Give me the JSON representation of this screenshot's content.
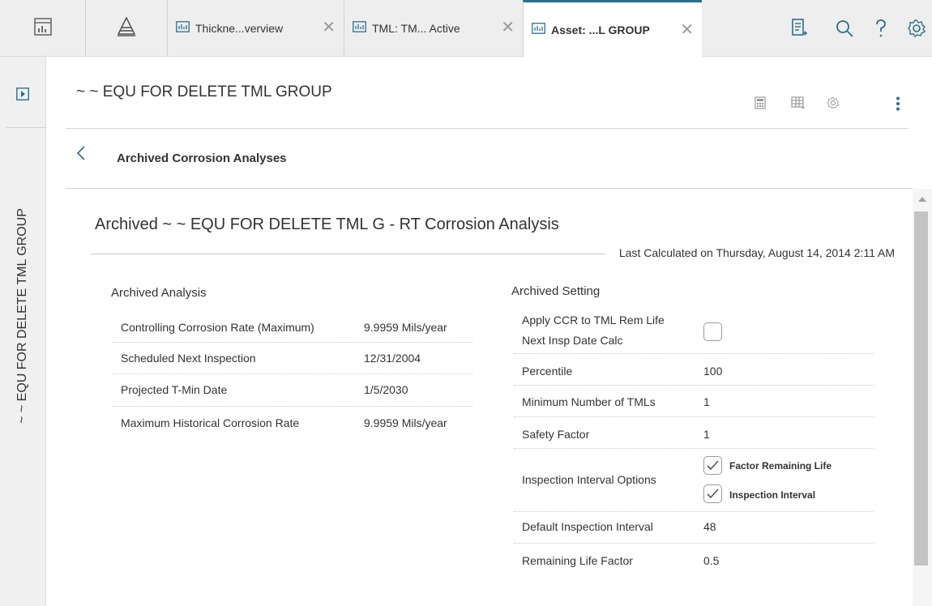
{
  "tabs": [
    {
      "label": "Thickne...verview",
      "icon": "chart-icon"
    },
    {
      "label": "TML: TM... Active",
      "icon": "chart-icon"
    },
    {
      "label": "Asset: ...L GROUP",
      "icon": "chart-icon",
      "active": true
    }
  ],
  "colors": {
    "accent": "#2b6f8e",
    "icon_gray": "#6a6a6a",
    "rail_bg": "#f0f0f0"
  },
  "rail": {
    "title": "~ ~ EQU FOR DELETE TML GROUP"
  },
  "header": {
    "asset_title": "~ ~ EQU FOR DELETE TML GROUP"
  },
  "section": {
    "label": "Archived Corrosion Analyses"
  },
  "analysis": {
    "title": "Archived ~ ~ EQU FOR DELETE TML G - RT Corrosion Analysis",
    "last_calculated": "Last Calculated on Thursday, August 14, 2014 2:11 AM"
  },
  "archived_analysis": {
    "title": "Archived Analysis",
    "rows": [
      {
        "label": "Controlling Corrosion Rate (Maximum)",
        "value": "9.9959 Mils/year"
      },
      {
        "label": "Scheduled Next Inspection",
        "value": "12/31/2004"
      },
      {
        "label": "Projected T-Min Date",
        "value": "1/5/2030"
      },
      {
        "label": "Maximum Historical Corrosion Rate",
        "value": "9.9959 Mils/year"
      }
    ]
  },
  "archived_setting": {
    "title": "Archived Setting",
    "apply_ccr": {
      "label_line1": "Apply CCR to TML Rem Life",
      "label_line2": "Next Insp Date Calc",
      "checked": false
    },
    "percentile": {
      "label": "Percentile",
      "value": "100"
    },
    "min_tmls": {
      "label": "Minimum Number of TMLs",
      "value": "1"
    },
    "safety_factor": {
      "label": "Safety Factor",
      "value": "1"
    },
    "interval_options": {
      "label": "Inspection Interval Options",
      "options": [
        {
          "label": "Factor Remaining Life",
          "checked": true
        },
        {
          "label": "Inspection Interval",
          "checked": true
        }
      ]
    },
    "default_interval": {
      "label": "Default Inspection Interval",
      "value": "48"
    },
    "remaining_life_factor": {
      "label": "Remaining Life Factor",
      "value": "0.5"
    }
  }
}
